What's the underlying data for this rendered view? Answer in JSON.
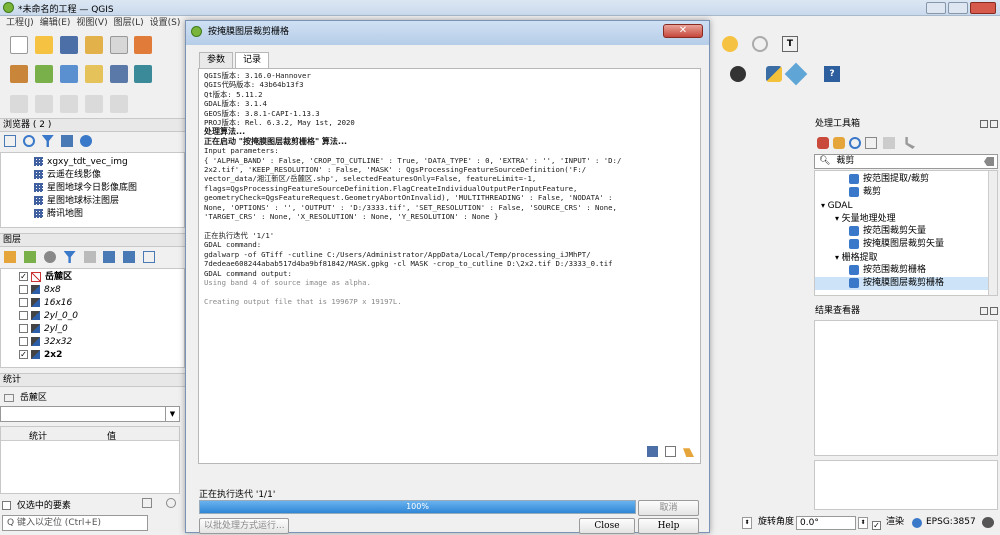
{
  "window": {
    "title": "*未命名的工程 — QGIS"
  },
  "menu": [
    "工程(J)",
    "编辑(E)",
    "视图(V)",
    "图层(L)",
    "设置(S)"
  ],
  "browser": {
    "title": "浏览器 ( 2 )",
    "items": [
      "xgxy_tdt_vec_img",
      "云遥在线影像",
      "星图地球今日影像底图",
      "星图地球标注图层",
      "腾讯地图"
    ]
  },
  "layers": {
    "title": "图层",
    "items": [
      {
        "name": "岳麓区",
        "checked": true,
        "bold": true,
        "vector": true
      },
      {
        "name": "8x8",
        "checked": false
      },
      {
        "name": "16x16",
        "checked": false
      },
      {
        "name": "2yl_0_0",
        "checked": false
      },
      {
        "name": "2yl_0",
        "checked": false
      },
      {
        "name": "32x32",
        "checked": false
      },
      {
        "name": "2x2",
        "checked": true,
        "bold": true
      }
    ]
  },
  "stats": {
    "title": "统计",
    "layer": "岳麓区",
    "col1": "统计",
    "col2": "值"
  },
  "bottom": {
    "selected_only": "仅选中的要素",
    "locate_placeholder": "Q 键入以定位 (Ctrl+E)",
    "rotation_label": "旋转角度",
    "rotation_value": "0.0°",
    "render": "渲染",
    "crs": "EPSG:3857"
  },
  "dialog": {
    "title": "按掩膜图层裁剪栅格",
    "tabs": [
      "参数",
      "记录"
    ],
    "log": [
      {
        "t": "QGIS版本: 3.16.0-Hannover"
      },
      {
        "t": "QGIS代码版本: 43b64b13f3"
      },
      {
        "t": "Qt版本: 5.11.2"
      },
      {
        "t": "GDAL版本: 3.1.4"
      },
      {
        "t": "GEOS版本: 3.8.1-CAPI-1.13.3"
      },
      {
        "t": "PROJ版本: Rel. 6.3.2, May 1st, 2020"
      },
      {
        "t": "处理算法...",
        "b": true
      },
      {
        "t": "正在启动 \"按掩膜图层裁剪栅格\" 算法...",
        "b": true
      },
      {
        "t": "Input parameters:"
      },
      {
        "t": "{ 'ALPHA_BAND' : False, 'CROP_TO_CUTLINE' : True, 'DATA_TYPE' : 0, 'EXTRA' : '', 'INPUT' : 'D:/"
      },
      {
        "t": "2x2.tif', 'KEEP_RESOLUTION' : False, 'MASK' : QgsProcessingFeatureSourceDefinition('F:/"
      },
      {
        "t": "vector_data/湘江新区/岳麓区.shp', selectedFeaturesOnly=False, featureLimit=-1,"
      },
      {
        "t": "flags=QgsProcessingFeatureSourceDefinition.FlagCreateIndividualOutputPerInputFeature,"
      },
      {
        "t": "geometryCheck=QgsFeatureRequest.GeometryAbortOnInvalid), 'MULTITHREADING' : False, 'NODATA' :"
      },
      {
        "t": "None, 'OPTIONS' : '', 'OUTPUT' : 'D:/3333.tif', 'SET_RESOLUTION' : False, 'SOURCE_CRS' : None,"
      },
      {
        "t": "'TARGET_CRS' : None, 'X_RESOLUTION' : None, 'Y_RESOLUTION' : None }"
      },
      {
        "t": " "
      },
      {
        "t": "正在执行迭代 '1/1'"
      },
      {
        "t": "GDAL command:"
      },
      {
        "t": "gdalwarp -of GTiff -cutline C:/Users/Administrator/AppData/Local/Temp/processing_iJMhPT/"
      },
      {
        "t": "7dedeae608244abab517d4ba9bf81842/MASK.gpkg -cl MASK -crop_to_cutline D:\\2x2.tif D:/3333_0.tif"
      },
      {
        "t": "GDAL command output:"
      },
      {
        "t": "Using band 4 of source image as alpha.",
        "g": true
      },
      {
        "t": " "
      },
      {
        "t": "Creating output file that is 19967P x 19197L.",
        "g": true
      }
    ],
    "status": "正在执行迭代 '1/1'",
    "progress_label": "100%",
    "progress": 1.0,
    "cancel": "取消",
    "batch": "以批处理方式运行...",
    "close": "Close",
    "help": "Help"
  },
  "toolbox": {
    "title": "处理工具箱",
    "search": "裁剪",
    "items": [
      {
        "label": "按范围提取/裁剪",
        "indent": 2
      },
      {
        "label": "裁剪",
        "indent": 2
      },
      {
        "label": "GDAL",
        "indent": 0
      },
      {
        "label": "矢量地理处理",
        "indent": 1
      },
      {
        "label": "按范围裁剪矢量",
        "indent": 2
      },
      {
        "label": "按掩膜图层裁剪矢量",
        "indent": 2
      },
      {
        "label": "栅格提取",
        "indent": 1
      },
      {
        "label": "按范围裁剪栅格",
        "indent": 2
      },
      {
        "label": "按掩膜图层裁剪栅格",
        "indent": 2
      }
    ]
  },
  "results": {
    "title": "结果查看器"
  },
  "colors": {
    "accent": "#2f86d6",
    "titlebar": "#c9d9ec"
  }
}
